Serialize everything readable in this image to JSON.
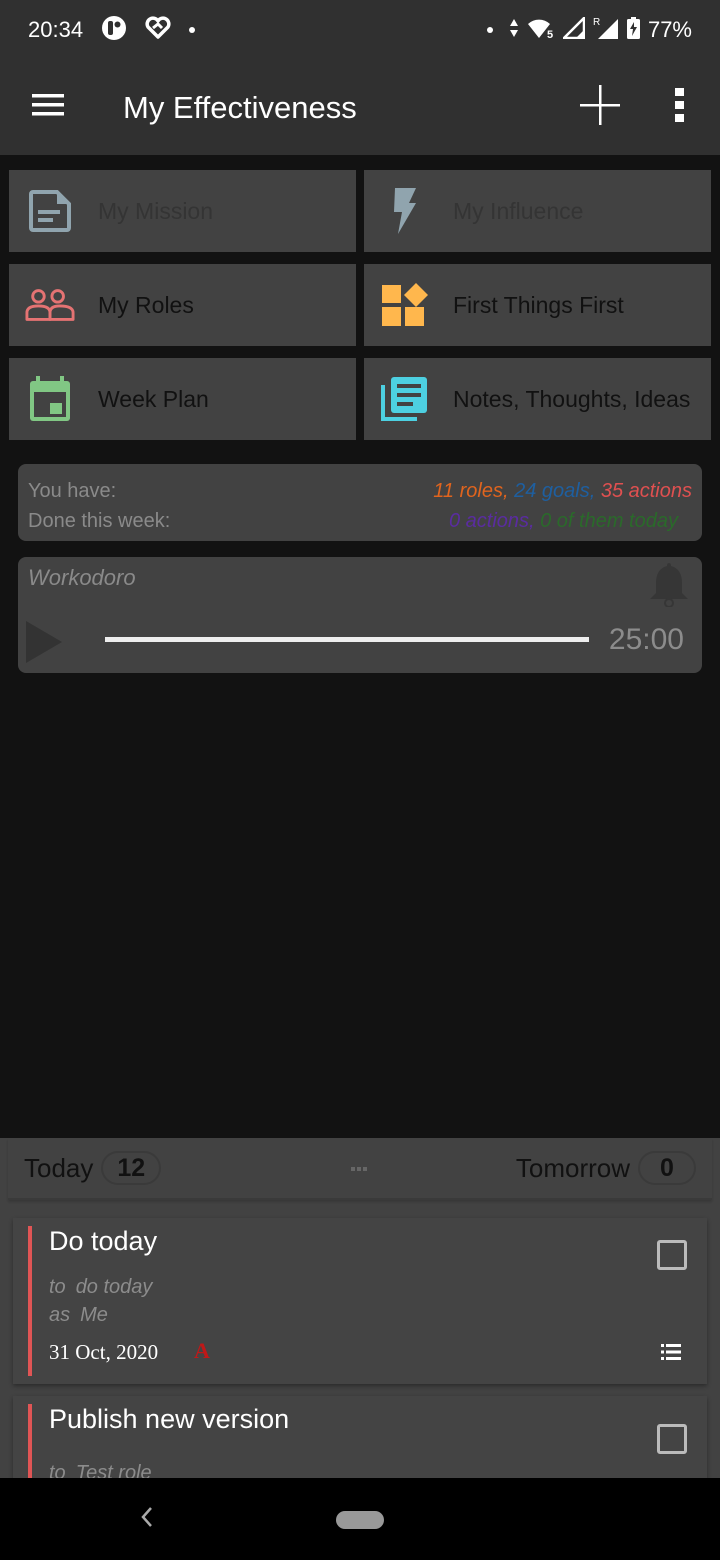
{
  "status_bar": {
    "time": "20:34",
    "left_icons": [
      "app-notification-icon",
      "heart-icon",
      "dot-icon"
    ],
    "right_icons": [
      "dot-icon",
      "data-arrows-icon",
      "wifi-icon",
      "signal-icon",
      "roaming-signal-icon",
      "battery-charging-icon"
    ],
    "roaming_label": "R",
    "wifi_label": "5",
    "battery": "77%"
  },
  "app_bar": {
    "title": "My Effectiveness",
    "menu_icon": "hamburger-menu-icon",
    "add_icon": "plus-icon",
    "overflow_icon": "more-vert-icon"
  },
  "tiles": [
    {
      "label": "My Mission",
      "icon": "document-icon",
      "color": "#90a4ae",
      "enabled": false
    },
    {
      "label": "My Influence",
      "icon": "lightning-icon",
      "color": "#90a4ae",
      "enabled": false
    },
    {
      "label": "My Roles",
      "icon": "people-icon",
      "color": "#e57373",
      "enabled": true
    },
    {
      "label": "First Things First",
      "icon": "widgets-icon",
      "color": "#ffb74d",
      "enabled": true
    },
    {
      "label": "Week Plan",
      "icon": "calendar-icon",
      "color": "#81c784",
      "enabled": true
    },
    {
      "label": "Notes, Thoughts, Ideas",
      "icon": "library-books-icon",
      "color": "#4dd0e1",
      "enabled": true
    }
  ],
  "stats": {
    "you_have_label": "You have:",
    "roles": "11 roles,",
    "goals": "24 goals,",
    "actions": "35 actions",
    "done_label": "Done this week:",
    "done_actions": "0 actions,",
    "done_today": "0 of them today",
    "colors": {
      "roles": "#e0641e",
      "goals": "#1e5fa0",
      "actions": "#e05050",
      "done_actions": "#5a2ca0",
      "done_today": "#2a6a2a"
    }
  },
  "workodoro": {
    "title": "Workodoro",
    "time": "25:00",
    "progress": 1.0
  },
  "bottom_sheet": {
    "today_label": "Today",
    "today_count": "12",
    "tomorrow_label": "Tomorrow",
    "tomorrow_count": "0",
    "tasks": [
      {
        "title": "Do today",
        "to_label": "to",
        "to_value": "do today",
        "as_label": "as",
        "as_value": "Me",
        "date": "31 Oct, 2020",
        "priority": "A",
        "checked": false
      },
      {
        "title": "Publish new version",
        "to_label": "to",
        "to_value": "Test role",
        "checked": false
      }
    ]
  },
  "nav_bar": {
    "back_icon": "back-chevron-icon",
    "home_icon": "home-pill-icon"
  }
}
